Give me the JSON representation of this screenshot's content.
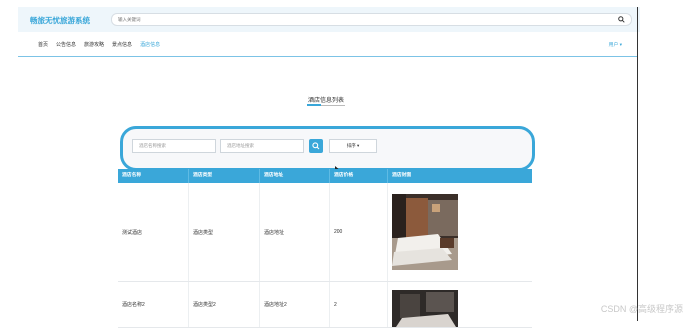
{
  "header": {
    "site_title": "畅旅无忧旅游系统",
    "search_placeholder": "输入关键词"
  },
  "nav": {
    "items": [
      {
        "label": "首页",
        "active": false
      },
      {
        "label": "公告信息",
        "active": false
      },
      {
        "label": "旅游攻略",
        "active": false
      },
      {
        "label": "景点信息",
        "active": false
      },
      {
        "label": "酒店信息",
        "active": true
      }
    ],
    "user_menu": "用户 ▾"
  },
  "section": {
    "title": "酒店信息列表"
  },
  "filters": {
    "hotel_name_placeholder": "酒店名称搜索",
    "hotel_address_placeholder": "酒店地址搜索",
    "sort_label": "排序 ▾"
  },
  "table": {
    "headers": [
      "酒店名称",
      "酒店类型",
      "酒店地址",
      "酒店价格",
      "酒店封面"
    ],
    "rows": [
      {
        "name": "测试酒店",
        "type": "酒店类型",
        "address": "酒店地址",
        "price": "200"
      },
      {
        "name": "酒店名称2",
        "type": "酒店类型2",
        "address": "酒店地址2",
        "price": "2"
      }
    ]
  },
  "watermark": "CSDN @高级程序源",
  "colors": {
    "accent": "#3aa7d9",
    "topbar_bg": "#eef6fb"
  }
}
